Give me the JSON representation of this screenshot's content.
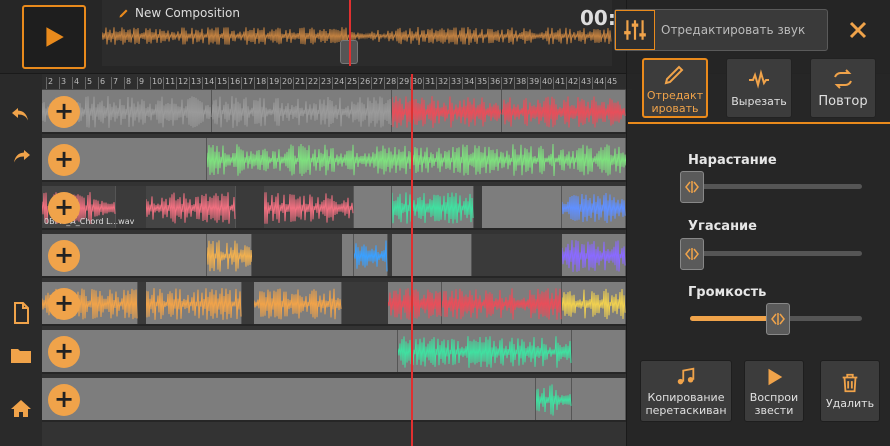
{
  "composition": {
    "title": "New Composition",
    "time": "00:"
  },
  "ruler": {
    "ticks": [
      "2",
      "3",
      "4",
      "5",
      "6",
      "7",
      "8",
      "9",
      "10",
      "11",
      "12",
      "13",
      "14",
      "15",
      "16",
      "17",
      "18",
      "19",
      "20",
      "21",
      "22",
      "23",
      "24",
      "25",
      "26",
      "27",
      "28",
      "29",
      "30",
      "31",
      "32",
      "33",
      "34",
      "35",
      "36",
      "37",
      "38",
      "39",
      "40",
      "41",
      "42",
      "43",
      "44",
      "45"
    ]
  },
  "tracks": [
    {
      "clip_label": ""
    },
    {
      "clip_label": ""
    },
    {
      "clip_label": "0BPM_A_Chord L...wav"
    },
    {
      "clip_label": ""
    },
    {
      "clip_label": ""
    },
    {
      "clip_label": ""
    },
    {
      "clip_label": ""
    }
  ],
  "panel": {
    "header": "Отредактировать звук",
    "modes": {
      "edit": "Отредакт ировать",
      "cut": "Вырезать",
      "repeat": "Повтор"
    },
    "sliders": {
      "fade_in": "Нарастание",
      "fade_out": "Угасание",
      "volume": "Громкость"
    },
    "actions": {
      "copy_drag": "Копирование перетаскиван",
      "play": "Воспрои звести",
      "delete": "Удалить"
    }
  },
  "slider_values": {
    "fade_in": 0.0,
    "fade_out": 0.0,
    "volume": 0.5
  },
  "colors": {
    "accent": "#e98a1c",
    "playhead": "#e03030",
    "add_button": "#f0a34a"
  }
}
